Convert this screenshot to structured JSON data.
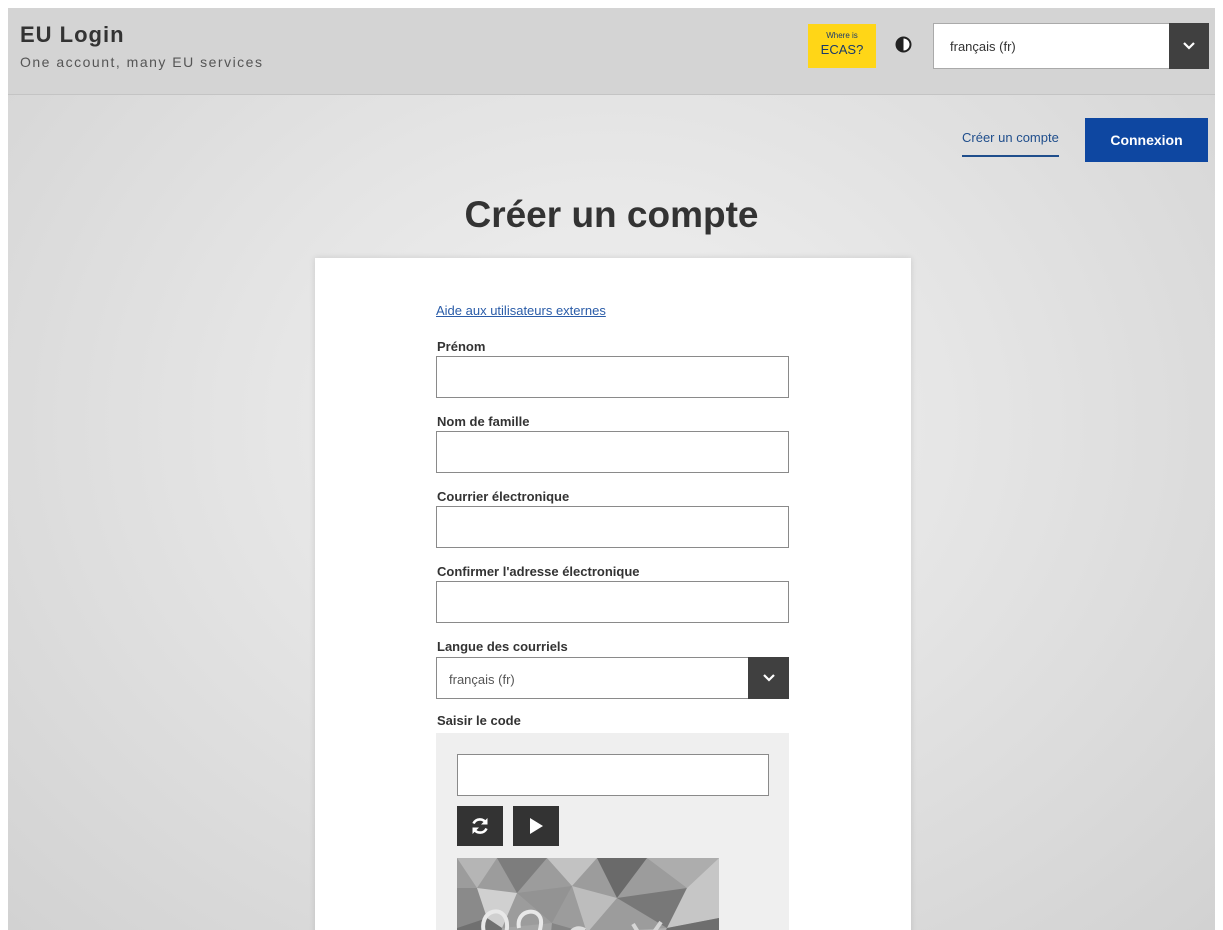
{
  "header": {
    "title": "EU Login",
    "tagline": "One account, many EU services",
    "ecas_badge": {
      "line1": "Where is",
      "line2": "ECAS?"
    },
    "contrast_icon": "contrast-icon",
    "language": {
      "value": "français (fr)",
      "icon": "chevron-down-icon"
    }
  },
  "nav": {
    "create_account": "Créer un compte",
    "login": "Connexion"
  },
  "page": {
    "title": "Créer un compte"
  },
  "form": {
    "help_link": "Aide aux utilisateurs externes",
    "fields": {
      "first_name": {
        "label": "Prénom",
        "value": ""
      },
      "last_name": {
        "label": "Nom de famille",
        "value": ""
      },
      "email": {
        "label": "Courrier électronique",
        "value": ""
      },
      "email_confirm": {
        "label": "Confirmer l'adresse électronique",
        "value": ""
      }
    },
    "email_language": {
      "label": "Langue des courriels",
      "value": "français (fr)"
    },
    "captcha": {
      "label": "Saisir le code",
      "value": "",
      "refresh_icon": "refresh-icon",
      "audio_icon": "play-icon"
    }
  },
  "colors": {
    "accent_blue": "#0e47a1",
    "link_blue": "#1f4e8c",
    "badge_yellow": "#ffd617",
    "dark_button": "#333333"
  }
}
